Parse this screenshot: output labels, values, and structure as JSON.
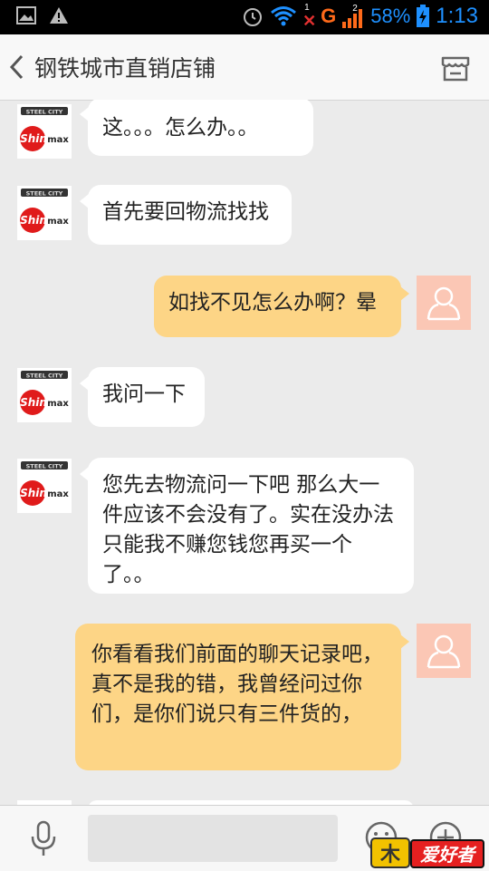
{
  "status_bar": {
    "battery": "58%",
    "time": "1:13",
    "network": "G",
    "signal_sim_number": "2",
    "wifi_sim_number": "1"
  },
  "header": {
    "title": "钢铁城市直销店铺",
    "back_icon": "chevron-left-icon",
    "store_icon": "store-icon"
  },
  "shop_avatar": {
    "brand_top": "STEEL CITY",
    "brand_name": "Shinmax"
  },
  "messages": [
    {
      "side": "in",
      "text": "这。。。怎么办。。"
    },
    {
      "side": "in",
      "text": "首先要回物流找找"
    },
    {
      "side": "out",
      "text": "如找不见怎么办啊？晕"
    },
    {
      "side": "in",
      "text": "我问一下"
    },
    {
      "side": "in",
      "text": "您先去物流问一下吧 那么大一件应该不会没有了。实在没办法只能我不赚您钱您再买一个了。。"
    },
    {
      "side": "out",
      "text": "你看看我们前面的聊天记录吧，真不是我的错，我曾经问过你们，是你们说只有三件货的，"
    }
  ],
  "input_bar": {
    "mic_icon": "microphone-icon",
    "emoji_icon": "emoji-icon",
    "plus_icon": "plus-icon",
    "text_value": ""
  },
  "watermark": {
    "text": "爱好者"
  },
  "colors": {
    "incoming_bubble": "#ffffff",
    "outgoing_bubble": "#fdd586",
    "user_avatar_bg": "#fbc7b5",
    "status_accent": "#1e90ff"
  }
}
